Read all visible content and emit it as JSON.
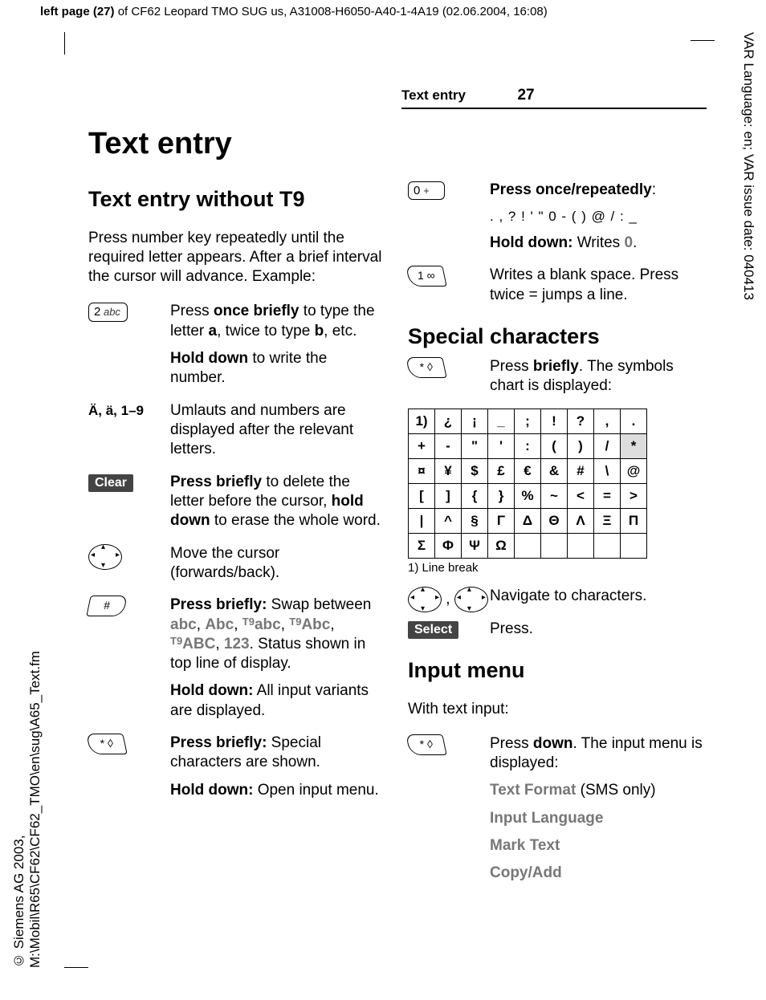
{
  "top_info_prefix": "left page (27)",
  "top_info_rest": " of CF62 Leopard TMO SUG us, A31008-H6050-A40-1-4A19 (02.06.2004, 16:08)",
  "side_right": "VAR Language: en; VAR issue date: 040413",
  "side_left": "© Siemens AG 2003, M:\\Mobil\\R65\\CF62\\CF62_TMO\\en\\sug\\A65_Text.fm",
  "header_section": "Text entry",
  "header_page": "27",
  "h1": "Text entry",
  "left": {
    "h2": "Text entry without T9",
    "intro": "Press number key repeatedly until the required letter appears. After a brief interval the cursor will advance. Example:",
    "rows": [
      {
        "key_text": "2 abc",
        "paras": [
          "Press <b>once briefly</b> to type the letter <b>a</b>, twice to type <b>b</b>, etc.",
          "<b>Hold down</b> to write the number."
        ]
      },
      {
        "label": "Ä, ä, 1–9",
        "paras": [
          "Umlauts and numbers are displayed after the relevant letters."
        ]
      },
      {
        "soft": "Clear",
        "paras": [
          "<b>Press briefly</b> to delete the letter before the cursor, <b>hold down</b> to erase the whole word."
        ]
      },
      {
        "nav_lr": true,
        "paras": [
          "Move the cursor (forwards/back)."
        ]
      },
      {
        "skew_r": "#",
        "paras": [
          "<b>Press briefly:</b> Swap between <span class=\"modes\">abc</span>, <span class=\"modes\">Abc</span>, <span class=\"modes\"><span class=\"t9\">T9</span>abc</span>, <span class=\"modes\"><span class=\"t9\">T9</span>Abc</span>, <span class=\"modes\"><span class=\"t9\">T9</span>ABC</span>, <span class=\"modes\">123</span>. Status shown in top line of display.",
          "<b>Hold down:</b> All input variants are displayed."
        ]
      },
      {
        "skew_l": "* ◊",
        "paras": [
          "<b>Press briefly:</b> Special characters are shown.",
          "<b>Hold down:</b> Open input menu."
        ]
      }
    ]
  },
  "right": {
    "zero": {
      "key_text": "0 +",
      "l1": "Press once/repeatedly",
      "chars": ". , ? ! ' \" 0 - ( ) @ / : _",
      "l3a": "Hold down:",
      "l3b": " Writes ",
      "l3c": "0",
      "l3d": "."
    },
    "one": {
      "skew_l": "1 ∞",
      "p": "Writes a blank space. Press twice = jumps a line."
    },
    "special_h2": "Special characters",
    "star": {
      "skew_l": "* ◊",
      "p1a": "Press ",
      "p1b": "briefly",
      "p1c": ". The symbols chart is displayed:"
    },
    "symbols": [
      [
        "1)",
        "¿",
        "¡",
        "_",
        ";",
        "!",
        "?",
        ",",
        "."
      ],
      [
        "+",
        "-",
        "\"",
        "'",
        ":",
        "(",
        ")",
        "/",
        "*"
      ],
      [
        "¤",
        "¥",
        "$",
        "£",
        "€",
        "&",
        "#",
        "\\",
        "@"
      ],
      [
        "[",
        "]",
        "{",
        "}",
        "%",
        "~",
        "<",
        "=",
        ">"
      ],
      [
        "|",
        "^",
        "§",
        "Γ",
        "Δ",
        "Θ",
        "Λ",
        "Ξ",
        "Π"
      ],
      [
        "Σ",
        "Φ",
        "Ψ",
        "Ω",
        "",
        "",
        "",
        "",
        ""
      ]
    ],
    "footnote": "1) Line break",
    "nav_text": "Navigate to characters.",
    "select_label": "Select",
    "select_text": "Press.",
    "input_h2": "Input menu",
    "input_intro": "With text input:",
    "input_star": {
      "skew_l": "* ◊",
      "p1a": "Press ",
      "p1b": "down",
      "p1c": ". The input menu is displayed:",
      "items": [
        {
          "t": "Text Format",
          "suffix": " (SMS only)"
        },
        {
          "t": "Input Language"
        },
        {
          "t": "Mark Text"
        },
        {
          "t": "Copy/Add"
        }
      ]
    }
  }
}
